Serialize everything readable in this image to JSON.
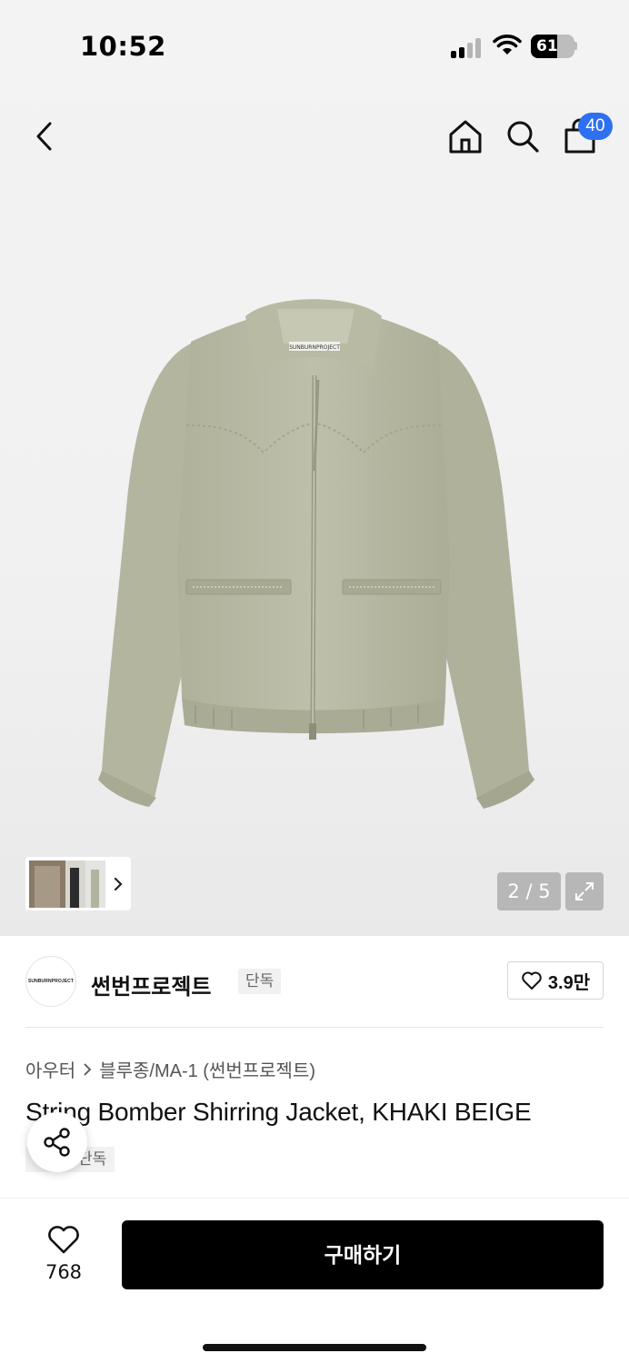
{
  "status_bar": {
    "time": "10:52",
    "battery": "61",
    "battery_level": 0.61
  },
  "nav": {
    "back_icon": "chevron-left-icon",
    "home_icon": "home-icon",
    "search_icon": "search-icon",
    "cart_icon": "shopping-bag-icon",
    "cart_count": "40"
  },
  "gallery": {
    "counter": "2 / 5",
    "brand_label_on_jacket": "SUNBURNPROJECT"
  },
  "brand": {
    "logo_text": "SUNBURNPROJECT",
    "name": "썬번프로젝트",
    "tag": "단독",
    "likes": "3.9만"
  },
  "product": {
    "breadcrumb": [
      "아우터",
      "블루종/MA-1 (썬번프로젝트)"
    ],
    "title": "String Bomber Shirring Jacket, KHAKI BEIGE",
    "exclusive_tag": "단독"
  },
  "bottom_bar": {
    "wish_count": "768",
    "buy_label": "구매하기"
  },
  "colors": {
    "accent_badge": "#2f6ff2",
    "buy_button": "#000000",
    "jacket": "#b8b9a4"
  }
}
